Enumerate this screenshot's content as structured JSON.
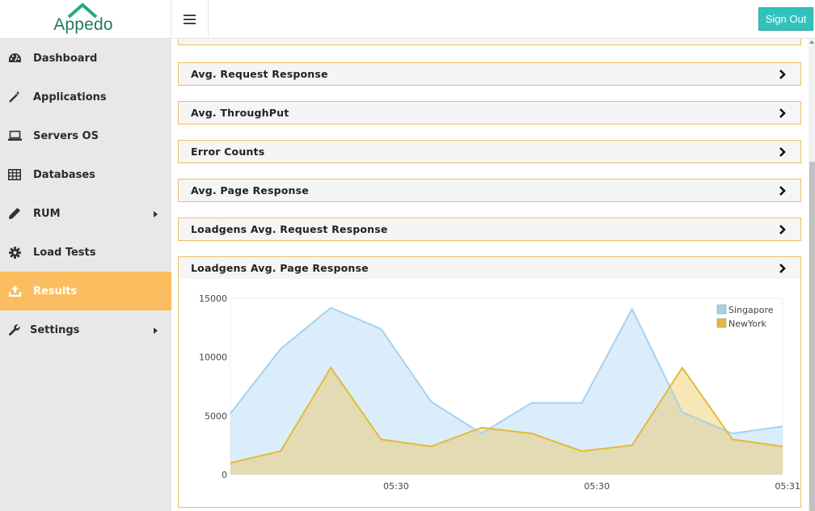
{
  "brand": {
    "name": "Appedo",
    "color": "#1e7a64"
  },
  "header": {
    "signout_label": "Sign Out",
    "signout_color": "#32c2bd"
  },
  "sidebar": {
    "items": [
      {
        "label": "Dashboard",
        "icon": "dashboard-icon",
        "active": false,
        "submenu": false
      },
      {
        "label": "Applications",
        "icon": "magic-wand-icon",
        "active": false,
        "submenu": false
      },
      {
        "label": "Servers OS",
        "icon": "laptop-icon",
        "active": false,
        "submenu": false
      },
      {
        "label": "Databases",
        "icon": "table-icon",
        "active": false,
        "submenu": false
      },
      {
        "label": "RUM",
        "icon": "pencil-icon",
        "active": false,
        "submenu": true
      },
      {
        "label": "Load Tests",
        "icon": "gear-icon",
        "active": false,
        "submenu": false
      },
      {
        "label": "Results",
        "icon": "upload-icon",
        "active": true,
        "submenu": false
      },
      {
        "label": "Settings",
        "icon": "wrench-icon",
        "active": false,
        "submenu": true
      }
    ],
    "active_color": "#fbbd5f"
  },
  "panels": [
    {
      "title": "Avg. Request Response"
    },
    {
      "title": "Avg. ThroughPut"
    },
    {
      "title": "Error Counts"
    },
    {
      "title": "Avg. Page Response"
    },
    {
      "title": "Loadgens Avg. Request Response"
    },
    {
      "title": "Loadgens Avg. Page Response"
    }
  ],
  "chart_data": {
    "type": "area",
    "ylim": [
      0,
      15000
    ],
    "y_ticks": [
      "15000",
      "10000",
      "5000",
      "0"
    ],
    "y_tick_values": [
      15000,
      10000,
      5000,
      0
    ],
    "x_tick_labels": [
      "05:30",
      "05:30",
      "05:31"
    ],
    "x_tick_indices": [
      3.3,
      7.3,
      11.1
    ],
    "legend_position": "top-right",
    "grid": false,
    "series": [
      {
        "name": "Singapore",
        "color": "#a6d1f0",
        "values": [
          5200,
          10700,
          14200,
          12400,
          6200,
          3500,
          6100,
          6100,
          14100,
          5300,
          3500,
          4100
        ]
      },
      {
        "name": "NewYork",
        "color": "#e6b93a",
        "values": [
          1000,
          2000,
          9100,
          3000,
          2400,
          4000,
          3500,
          2000,
          2500,
          9100,
          3000,
          2400
        ]
      }
    ]
  }
}
